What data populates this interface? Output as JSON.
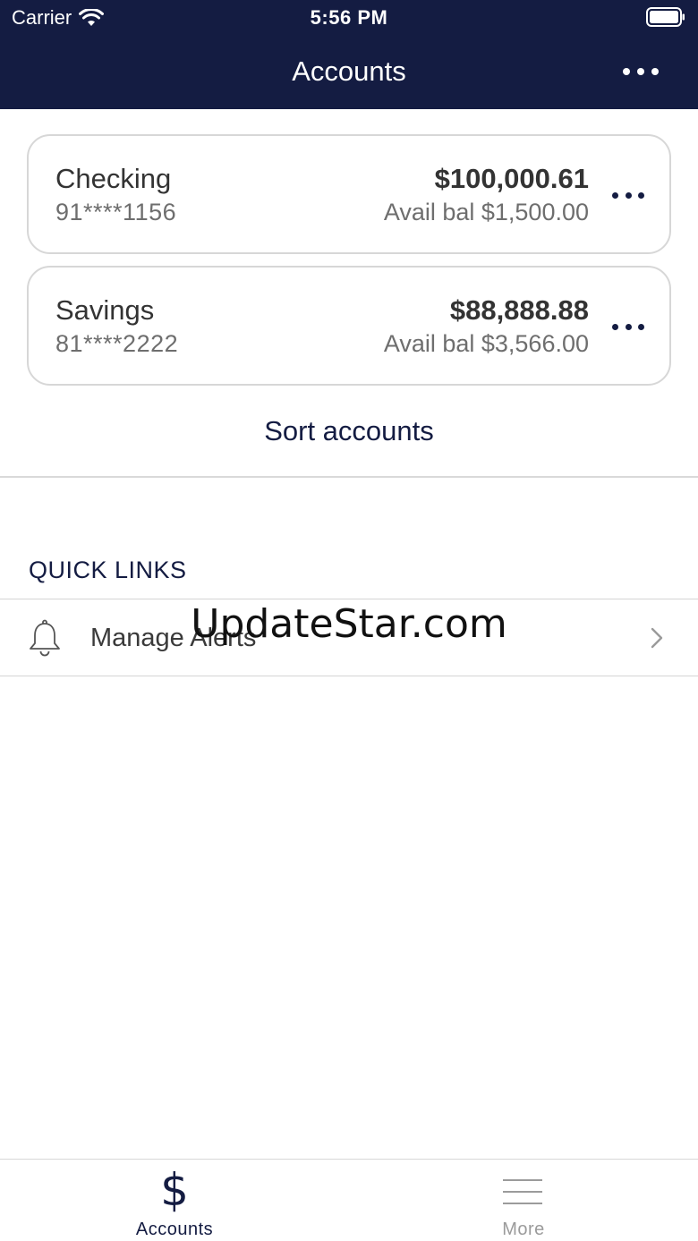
{
  "status_bar": {
    "carrier": "Carrier",
    "time": "5:56 PM"
  },
  "nav": {
    "title": "Accounts",
    "more_icon": "ellipsis-icon"
  },
  "accounts": [
    {
      "name": "Checking",
      "number": "91****1156",
      "balance": "$100,000.61",
      "available": "Avail bal $1,500.00"
    },
    {
      "name": "Savings",
      "number": "81****2222",
      "balance": "$88,888.88",
      "available": "Avail bal $3,566.00"
    }
  ],
  "sort_accounts_label": "Sort accounts",
  "quick_links": {
    "title": "QUICK LINKS",
    "items": [
      {
        "label": "Manage Alerts",
        "icon": "bell-icon"
      }
    ]
  },
  "watermark": "UpdateStar.com",
  "tabbar": {
    "tabs": [
      {
        "label": "Accounts",
        "icon": "dollar-icon",
        "active": true
      },
      {
        "label": "More",
        "icon": "menu-icon",
        "active": false
      }
    ]
  },
  "colors": {
    "brand_navy": "#141c42",
    "card_border": "#d7d7d7",
    "muted_text": "#6e6e6e",
    "inactive_tab": "#9b9b9b"
  }
}
